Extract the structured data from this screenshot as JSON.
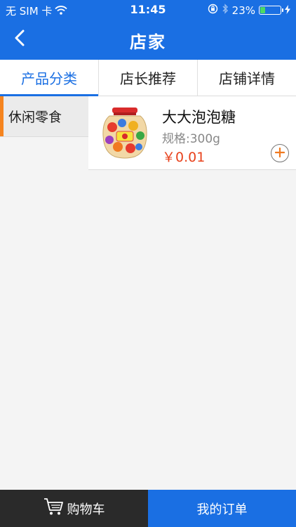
{
  "status_bar": {
    "carrier": "无 SIM 卡",
    "time": "11:45",
    "battery_percent": "23%",
    "battery_level": 0.23,
    "icons": [
      "wifi-icon",
      "orientation-lock-icon",
      "bluetooth-icon",
      "battery-icon",
      "charging-icon"
    ]
  },
  "nav": {
    "title": "店家",
    "back_icon": "chevron-left-icon"
  },
  "tabs": [
    {
      "label": "产品分类",
      "active": true
    },
    {
      "label": "店长推荐",
      "active": false
    },
    {
      "label": "店铺详情",
      "active": false
    }
  ],
  "categories": [
    {
      "label": "休闲零食",
      "active": true
    }
  ],
  "products": [
    {
      "name": "大大泡泡糖",
      "spec": "规格:300g",
      "price": "￥0.01",
      "image": "candy-jar-image",
      "add_icon": "plus-circle-icon"
    }
  ],
  "bottom_bar": {
    "cart_label": "购物车",
    "cart_icon": "cart-icon",
    "orders_label": "我的订单"
  },
  "colors": {
    "primary": "#1a6fe3",
    "accent": "#f5841f",
    "price": "#e8421c",
    "dark": "#2a2a2a"
  }
}
